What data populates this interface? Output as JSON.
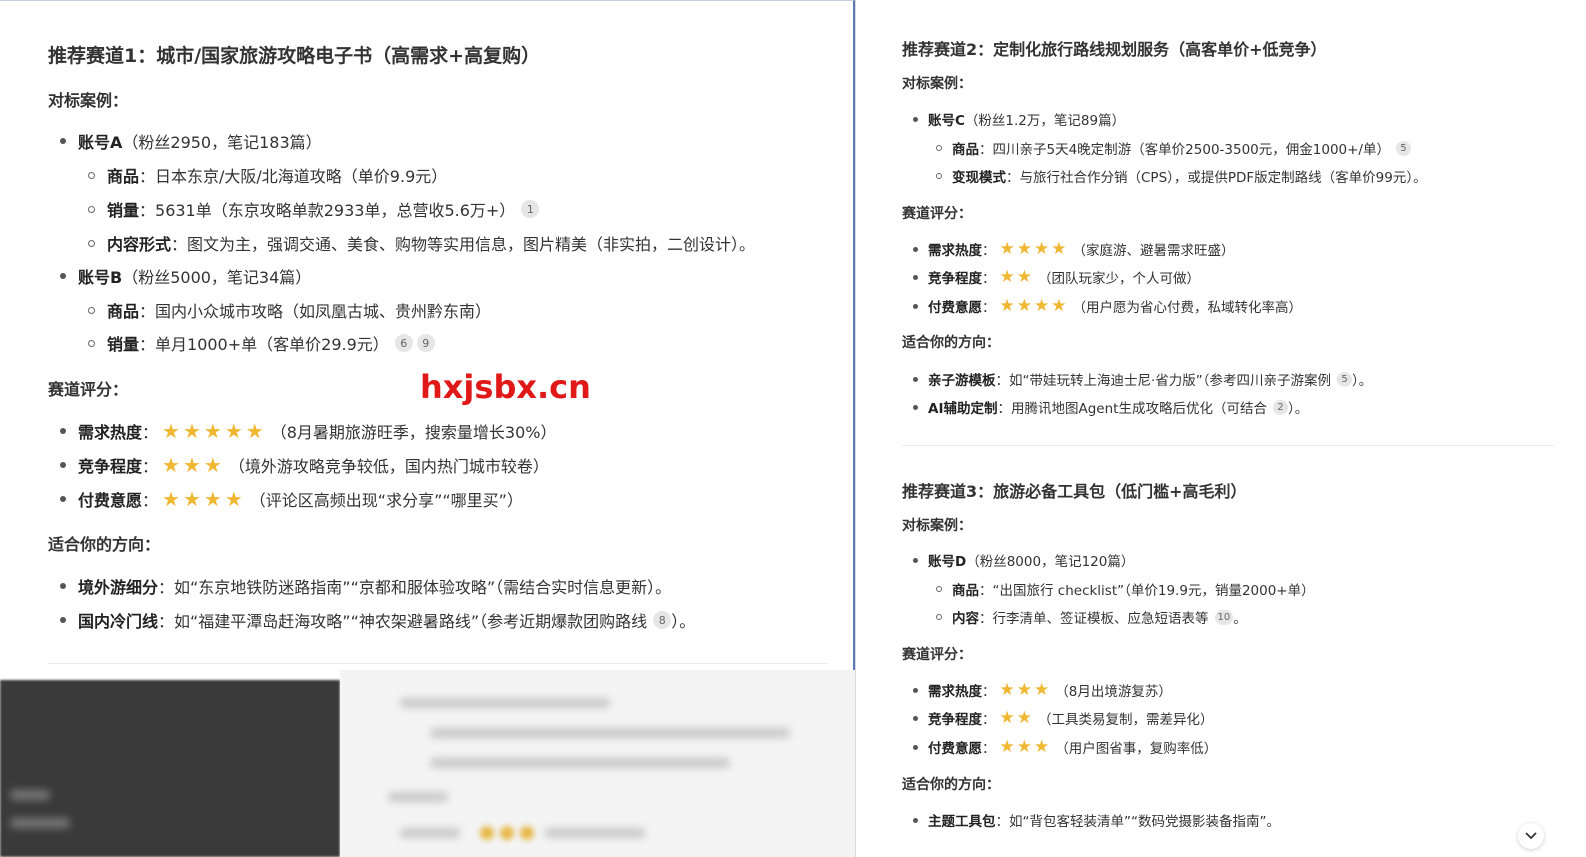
{
  "watermark": "hxjsbx.cn",
  "left": {
    "title": "推荐赛道1：城市/国家旅游攻略电子书（高需求+高复购）",
    "cases_label": "对标案例：",
    "accountA": {
      "name": "账号A",
      "meta": "（粉丝2950，笔记183篇）"
    },
    "accountA_product": {
      "label": "商品",
      "text": "：日本东京/大阪/北海道攻略（单价9.9元）"
    },
    "accountA_sales": {
      "label": "销量",
      "text": "：5631单（东京攻略单款2933单，总营收5.6万+）",
      "cite": "1"
    },
    "accountA_form": {
      "label": "内容形式",
      "text": "：图文为主，强调交通、美食、购物等实用信息，图片精美（非实拍，二创设计）。"
    },
    "accountB": {
      "name": "账号B",
      "meta": "（粉丝5000，笔记34篇）"
    },
    "accountB_product": {
      "label": "商品",
      "text": "：国内小众城市攻略（如凤凰古城、贵州黔东南）"
    },
    "accountB_sales": {
      "label": "销量",
      "text": "：单月1000+单（客单价29.9元）",
      "cite1": "6",
      "cite2": "9"
    },
    "score_label": "赛道评分：",
    "demand": {
      "label": "需求热度",
      "colon": "：",
      "stars": 5,
      "text": "（8月暑期旅游旺季，搜索量增长30%）"
    },
    "competition": {
      "label": "竞争程度",
      "colon": "：",
      "stars": 3,
      "text": "（境外游攻略竞争较低，国内热门城市较卷）"
    },
    "willingness": {
      "label": "付费意愿",
      "colon": "：",
      "stars": 4,
      "text": "（评论区高频出现“求分享”“哪里买”）"
    },
    "direction_label": "适合你的方向：",
    "dir1": {
      "label": "境外游细分",
      "text": "：如“东京地铁防迷路指南”“京都和服体验攻略”（需结合实时信息更新）。"
    },
    "dir2": {
      "label": "国内冷门线",
      "text": "：如“福建平潭岛赶海攻略”“神农架避暑路线”（参考近期爆款团购路线",
      "cite": "8",
      "tail": "）。"
    }
  },
  "right": {
    "title2": "推荐赛道2：定制化旅行路线规划服务（高客单价+低竞争）",
    "cases_label": "对标案例：",
    "accountC": {
      "name": "账号C",
      "meta": "（粉丝1.2万，笔记89篇）"
    },
    "accountC_product": {
      "label": "商品",
      "text": "：四川亲子5天4晚定制游（客单价2500-3500元，佣金1000+/单）",
      "cite": "5"
    },
    "accountC_mode": {
      "label": "变现模式",
      "text": "：与旅行社合作分销（CPS），或提供PDF版定制路线（客单价99元）。"
    },
    "score_label": "赛道评分：",
    "demand": {
      "label": "需求热度",
      "colon": "：",
      "stars": 4,
      "text": "（家庭游、避暑需求旺盛）"
    },
    "competition": {
      "label": "竞争程度",
      "colon": "：",
      "stars": 2,
      "text": "（团队玩家少，个人可做）"
    },
    "willingness": {
      "label": "付费意愿",
      "colon": "：",
      "stars": 4,
      "text": "（用户愿为省心付费，私域转化率高）"
    },
    "direction_label": "适合你的方向：",
    "dir1": {
      "label": "亲子游模板",
      "text": "：如“带娃玩转上海迪士尼·省力版”（参考四川亲子游案例",
      "cite": "5",
      "tail": "）。"
    },
    "dir2": {
      "label": "AI辅助定制",
      "text": "：用腾讯地图Agent生成攻略后优化（可结合",
      "cite": "2",
      "tail": "）。"
    },
    "title3": "推荐赛道3：旅游必备工具包（低门槛+高毛利）",
    "cases_label3": "对标案例：",
    "accountD": {
      "name": "账号D",
      "meta": "（粉丝8000，笔记120篇）"
    },
    "accountD_product": {
      "label": "商品",
      "text": "：“出国旅行 checklist”（单价19.9元，销量2000+单）"
    },
    "accountD_content": {
      "label": "内容",
      "text": "：行李清单、签证模板、应急短语表等",
      "cite": "10",
      "tail": "。"
    },
    "score_label3": "赛道评分：",
    "demand3": {
      "label": "需求热度",
      "colon": "：",
      "stars": 3,
      "text": "（8月出境游复苏）"
    },
    "competition3": {
      "label": "竞争程度",
      "colon": "：",
      "stars": 2,
      "text": "（工具类易复制，需差异化）"
    },
    "willingness3": {
      "label": "付费意愿",
      "colon": "：",
      "stars": 3,
      "text": "（用户图省事，复购率低）"
    },
    "direction_label3": "适合你的方向：",
    "dir3": {
      "label": "主题工具包",
      "text": "：如“背包客轻装清单”“数码党摄影装备指南”。"
    }
  },
  "scroll_icon": "chevron-down-icon",
  "colors": {
    "star": "#f0b733",
    "watermark": "#e01818",
    "panel_border": "#5a78b8"
  }
}
